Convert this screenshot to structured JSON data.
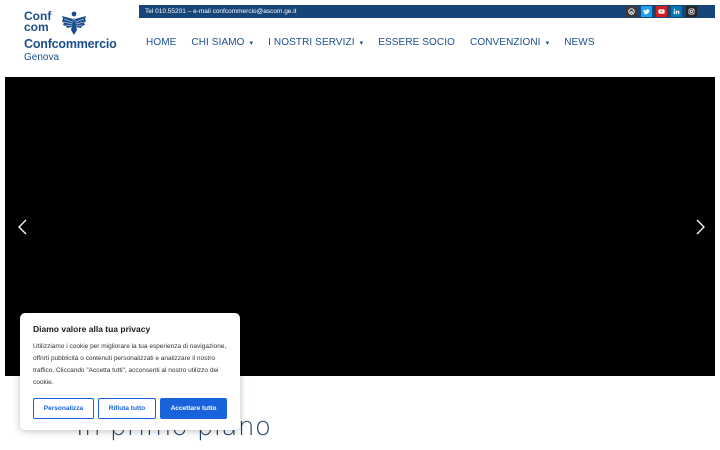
{
  "logo": {
    "top_text": "Conf\ncom",
    "name": "Confcommercio",
    "city": "Genova"
  },
  "topbar": {
    "contact": "Tel 010.55201 – e-mail confcommercio@ascom.ge.it",
    "socials": [
      {
        "name": "wordpress-icon",
        "bg": "#3a3a3a"
      },
      {
        "name": "twitter-icon",
        "bg": "#1da1f2"
      },
      {
        "name": "youtube-icon",
        "bg": "#cd201f"
      },
      {
        "name": "linkedin-icon",
        "bg": "#0077b5"
      },
      {
        "name": "instagram-icon",
        "bg": "#262626"
      }
    ]
  },
  "nav": {
    "home": "HOME",
    "chi_siamo": "CHI SIAMO",
    "servizi": "I NOSTRI SERVIZI",
    "essere_socio": "ESSERE SOCIO",
    "convenzioni": "CONVENZIONI",
    "news": "NEWS"
  },
  "section": {
    "heading": "In primo piano"
  },
  "cookie": {
    "title": "Diamo valore alla tua privacy",
    "text": "Utilizziamo i cookie per migliorare la tua esperienza di navigazione, offrirti pubblicità o contenuti personalizzati e analizzare il nostro traffico. Cliccando \"Accetta tutti\", acconsenti al nostro utilizzo dei cookie.",
    "customize": "Personalizza",
    "reject": "Rifiuta tutto",
    "accept": "Accettare tutto"
  },
  "colors": {
    "brand": "#1b4f8c",
    "topbar": "#164578",
    "accept": "#1863dc"
  }
}
